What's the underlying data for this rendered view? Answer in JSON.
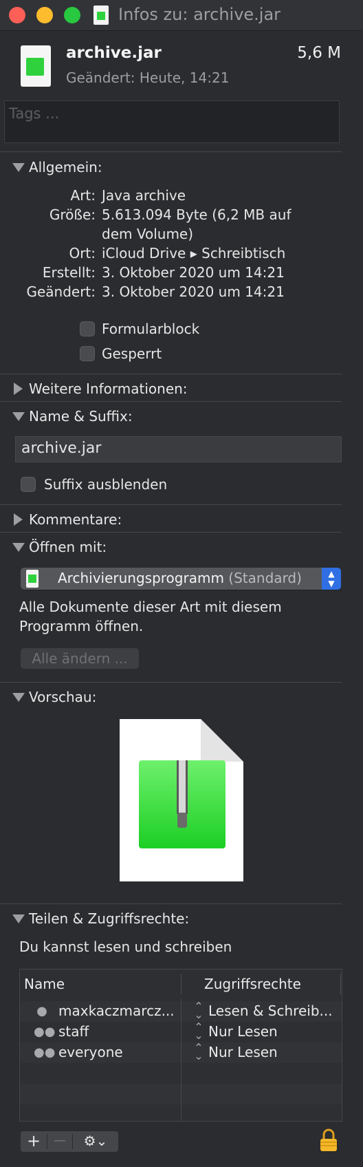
{
  "window": {
    "title": "Infos zu: archive.jar",
    "buttons": [
      "close",
      "minimize",
      "zoom"
    ]
  },
  "header": {
    "file_name": "archive.jar",
    "file_size": "5,6 M",
    "modified": "Geändert: Heute, 14:21",
    "icon": "jar-archive-icon",
    "tags_placeholder": "Tags ..."
  },
  "general": {
    "label": "Allgemein:",
    "expanded": true,
    "rows": [
      {
        "key": "Art:",
        "value": "Java archive"
      },
      {
        "key": "Größe:",
        "value": "5.613.094 Byte (6,2 MB auf",
        "value2": "dem Volume)"
      },
      {
        "key": "Ort:",
        "value": "iCloud Drive ▸ Schreibtisch"
      },
      {
        "key": "Erstellt:",
        "value": "3. Oktober 2020 um 14:21"
      },
      {
        "key": "Geändert:",
        "value": "3. Oktober 2020 um 14:21"
      }
    ],
    "checkboxes": [
      {
        "label": "Formularblock",
        "checked": false
      },
      {
        "label": "Gesperrt",
        "checked": false
      }
    ]
  },
  "more_info": {
    "label": "Weitere Informationen:",
    "expanded": false
  },
  "name_suffix": {
    "label": "Name & Suffix:",
    "expanded": true,
    "value": "archive.jar",
    "hide_suffix_label": "Suffix ausblenden",
    "hide_suffix_checked": false
  },
  "comments": {
    "label": "Kommentare:",
    "expanded": false
  },
  "open_with": {
    "label": "Öffnen mit:",
    "expanded": true,
    "app": "Archivierungsprogramm",
    "app_suffix": "(Standard)",
    "description": "Alle Dokumente dieser Art mit diesem Programm öffnen.",
    "change_all_label": "Alle ändern ..."
  },
  "preview": {
    "label": "Vorschau:",
    "expanded": true,
    "icon": "zip-archive-document-icon"
  },
  "sharing": {
    "label": "Teilen & Zugriffsrechte:",
    "expanded": true,
    "summary": "Du kannst lesen und schreiben",
    "columns": [
      "Name",
      "Zugriffsrechte"
    ],
    "rows": [
      {
        "user": "maxkaczmarcz...",
        "icon": "user-icon",
        "permission": "Lesen & Schreib..."
      },
      {
        "user": "staff",
        "icon": "group-icon",
        "permission": "Nur Lesen"
      },
      {
        "user": "everyone",
        "icon": "everyone-icon",
        "permission": "Nur Lesen"
      }
    ],
    "add_label": "+",
    "remove_label": "—",
    "action_label": "⚙⌄",
    "lock_icon": "lock-icon"
  },
  "colors": {
    "background": "#2b2c2f",
    "accent": "#2f6fe3",
    "close": "#fe5f57",
    "minimize": "#fdbc2e",
    "zoom": "#28c840",
    "archive_green": "#2fd23d"
  }
}
